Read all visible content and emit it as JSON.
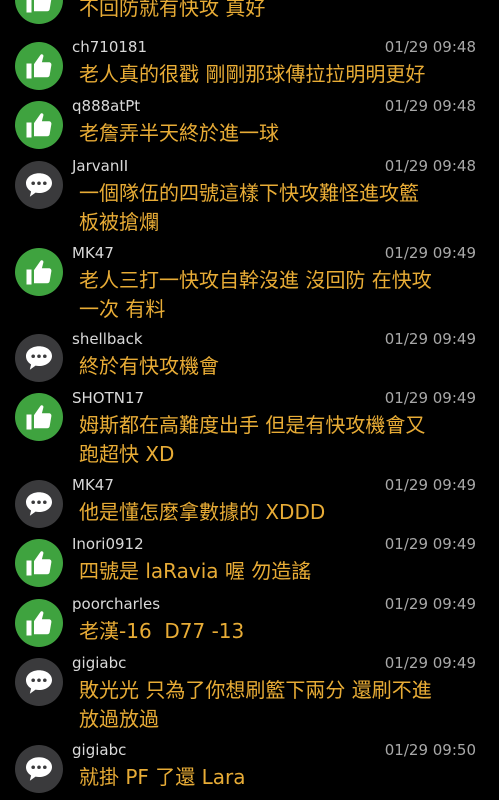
{
  "comments": [
    {
      "type": "push",
      "icon": "thumbs-up-icon",
      "user": "",
      "time": "",
      "text": "不回防就有快攻 真好"
    },
    {
      "type": "push",
      "icon": "thumbs-up-icon",
      "user": "ch710181",
      "time": "01/29 09:48",
      "text": "老人真的很戳 剛剛那球傳拉拉明明更好"
    },
    {
      "type": "push",
      "icon": "thumbs-up-icon",
      "user": "q888atPt",
      "time": "01/29 09:48",
      "text": "老詹弄半天終於進一球"
    },
    {
      "type": "arrow",
      "icon": "speech-bubble-icon",
      "user": "JarvanII",
      "time": "01/29 09:48",
      "text": "一個隊伍的四號這樣下快攻難怪進攻籃\n板被搶爛"
    },
    {
      "type": "push",
      "icon": "thumbs-up-icon",
      "user": "MK47",
      "time": "01/29 09:49",
      "text": "老人三打一快攻自幹沒進 沒回防 在快攻\n一次 有料"
    },
    {
      "type": "arrow",
      "icon": "speech-bubble-icon",
      "user": "shellback",
      "time": "01/29 09:49",
      "text": "終於有快攻機會"
    },
    {
      "type": "push",
      "icon": "thumbs-up-icon",
      "user": "SHOTN17",
      "time": "01/29 09:49",
      "text": "姆斯都在高難度出手 但是有快攻機會又\n跑超快 XD"
    },
    {
      "type": "arrow",
      "icon": "speech-bubble-icon",
      "user": "MK47",
      "time": "01/29 09:49",
      "text": "他是懂怎麼拿數據的 XDDD"
    },
    {
      "type": "push",
      "icon": "thumbs-up-icon",
      "user": "Inori0912",
      "time": "01/29 09:49",
      "text": "四號是 laRavia 喔 勿造謠"
    },
    {
      "type": "push",
      "icon": "thumbs-up-icon",
      "user": "poorcharles",
      "time": "01/29 09:49",
      "text": "老漢-16  D77 -13"
    },
    {
      "type": "arrow",
      "icon": "speech-bubble-icon",
      "user": "gigiabc",
      "time": "01/29 09:49",
      "text": "敗光光 只為了你想刷籃下兩分 還刷不進\n放過放過"
    },
    {
      "type": "arrow",
      "icon": "speech-bubble-icon",
      "user": "gigiabc",
      "time": "01/29 09:50",
      "text": "就掛 PF 了還 Lara"
    }
  ]
}
